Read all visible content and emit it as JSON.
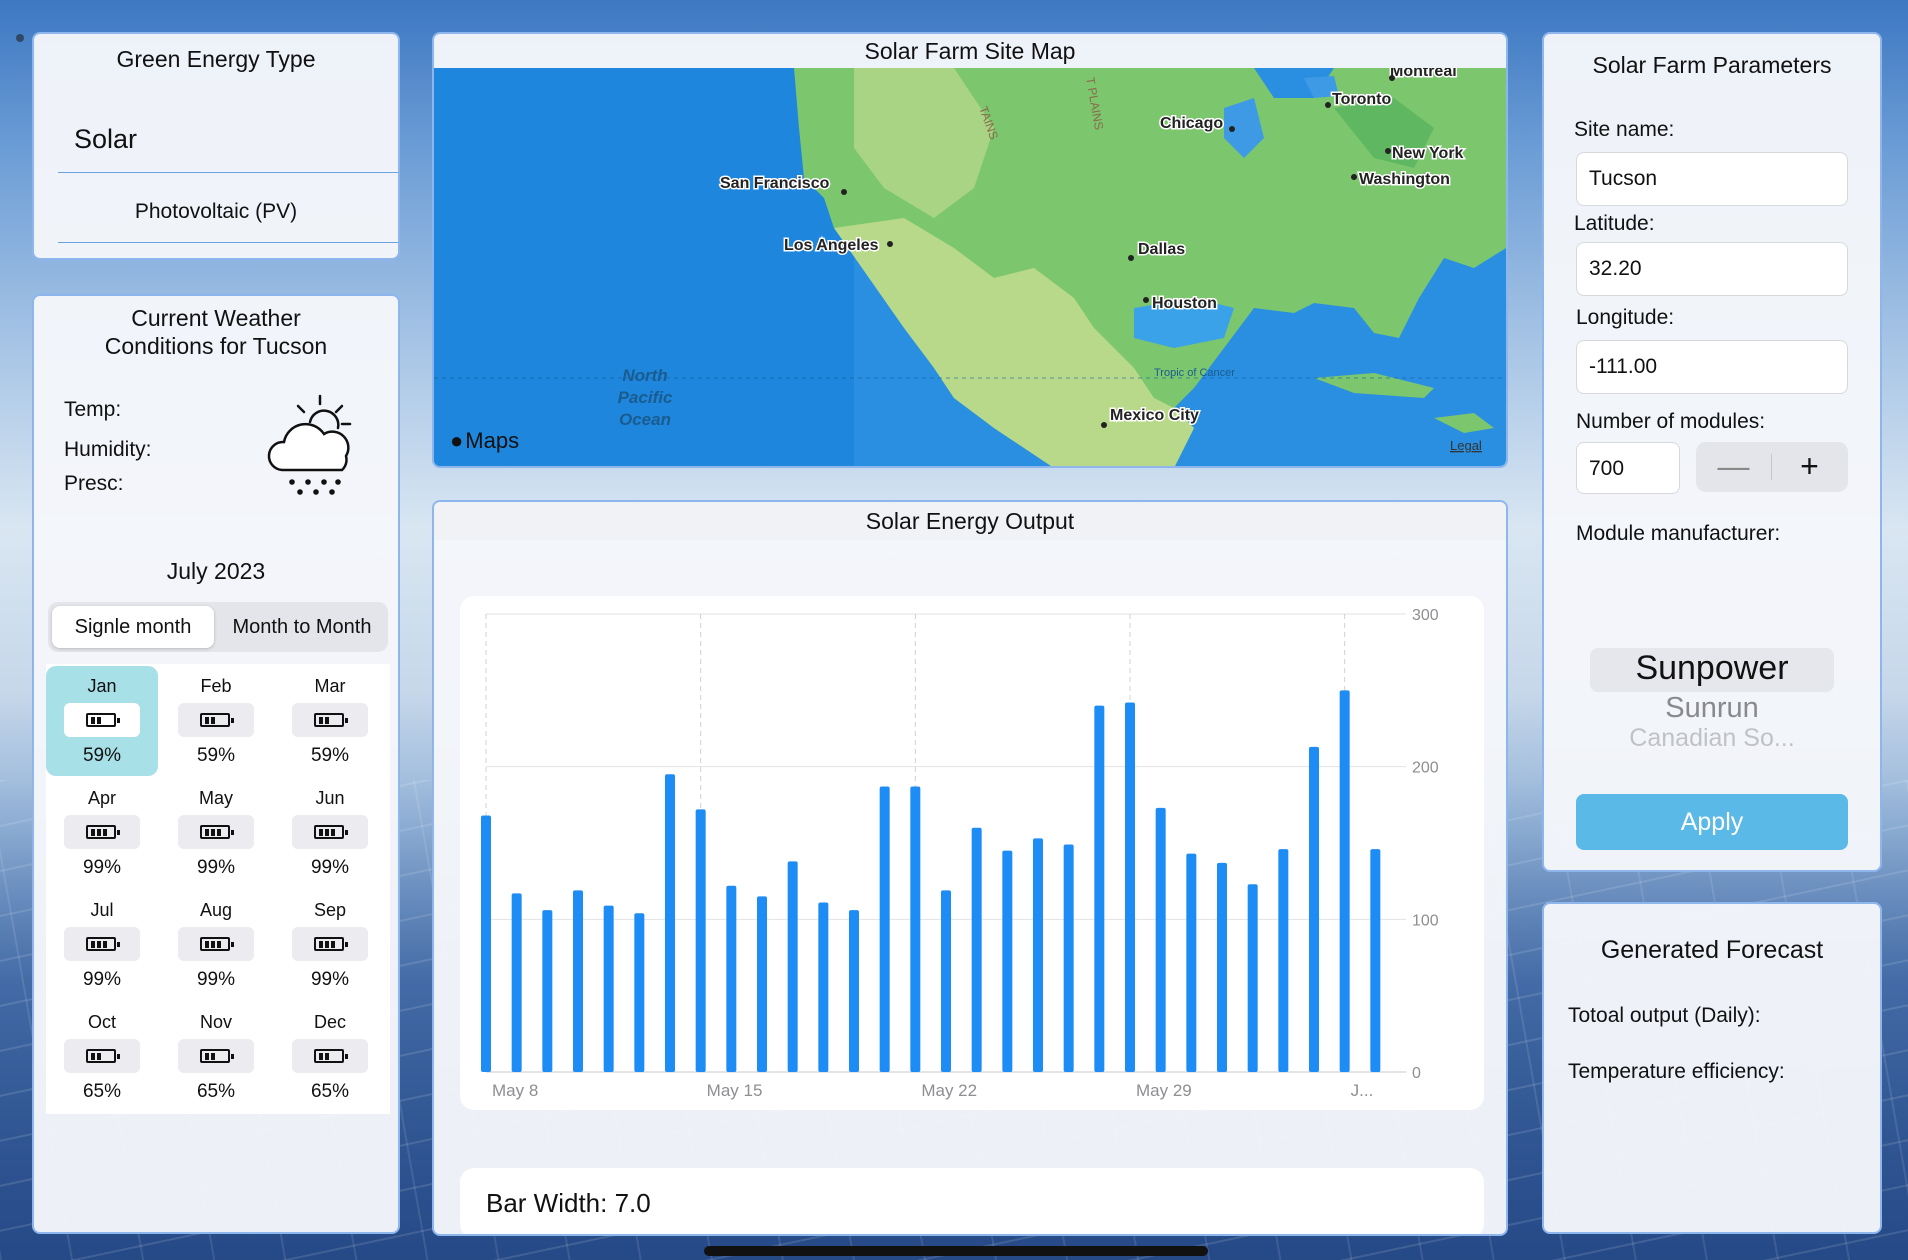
{
  "energy": {
    "title": "Green Energy Type",
    "selected": "Solar",
    "subtype": "Photovoltaic (PV)"
  },
  "weather": {
    "title": "Current Weather Conditions for Tucson",
    "labels": [
      "Temp:",
      "Humidity:",
      "Presc:"
    ],
    "icon": "cloud-sun-snow-icon",
    "month": "July 2023",
    "segments": [
      "Signle month",
      "Month to Month"
    ],
    "selected_segment": 0,
    "months": [
      {
        "name": "Jan",
        "pct": "59%",
        "selected": true
      },
      {
        "name": "Feb",
        "pct": "59%"
      },
      {
        "name": "Mar",
        "pct": "59%"
      },
      {
        "name": "Apr",
        "pct": "99%"
      },
      {
        "name": "May",
        "pct": "99%"
      },
      {
        "name": "Jun",
        "pct": "99%"
      },
      {
        "name": "Jul",
        "pct": "99%"
      },
      {
        "name": "Aug",
        "pct": "99%"
      },
      {
        "name": "Sep",
        "pct": "99%"
      },
      {
        "name": "Oct",
        "pct": "65%"
      },
      {
        "name": "Nov",
        "pct": "65%"
      },
      {
        "name": "Dec",
        "pct": "65%"
      }
    ]
  },
  "map": {
    "title": "Solar Farm Site Map",
    "attribution": "Maps",
    "legal": "Legal",
    "cities": [
      "Montreal",
      "Toronto",
      "Chicago",
      "New York",
      "Washington",
      "San Francisco",
      "Los Angeles",
      "Dallas",
      "Houston",
      "Mexico City"
    ],
    "ocean_label": [
      "North",
      "Pacific",
      "Ocean"
    ],
    "tropic_label": "Tropic of Cancer",
    "region_labels": [
      "TAINS",
      "T PLAINS"
    ]
  },
  "chart_title": "Solar Energy Output",
  "chart_data": {
    "type": "bar",
    "x": [
      "May 8",
      "May 9",
      "May 10",
      "May 11",
      "May 12",
      "May 13",
      "May 14",
      "May 15",
      "May 16",
      "May 17",
      "May 18",
      "May 19",
      "May 20",
      "May 21",
      "May 22",
      "May 23",
      "May 24",
      "May 25",
      "May 26",
      "May 27",
      "May 28",
      "May 29",
      "May 30",
      "May 31",
      "Jun 1",
      "Jun 2",
      "Jun 3",
      "Jun 4",
      "Jun 5",
      "Jun 6"
    ],
    "values": [
      168,
      117,
      106,
      119,
      109,
      104,
      195,
      172,
      122,
      115,
      138,
      111,
      106,
      187,
      187,
      119,
      160,
      145,
      153,
      149,
      240,
      242,
      173,
      143,
      137,
      123,
      146,
      213,
      250,
      146
    ],
    "x_tick_labels": [
      "May 8",
      "May 15",
      "May 22",
      "May 29",
      "J..."
    ],
    "y_ticks": [
      0,
      100,
      200,
      300
    ],
    "ylim": [
      0,
      300
    ],
    "grid": true,
    "y_axis_side": "right",
    "bar_color": "#1e8cf5"
  },
  "bar_width_label": "Bar Width: 7.0",
  "params": {
    "title": "Solar Farm Parameters",
    "site_label": "Site name:",
    "site_value": "Tucson",
    "lat_label": "Latitude:",
    "lat_value": "32.20",
    "lon_label": "Longitude:",
    "lon_value": "-111.00",
    "modules_label": "Number of modules:",
    "modules_value": "700",
    "stepper_minus": "—",
    "stepper_plus": "+",
    "manufacturer_label": "Module manufacturer:",
    "manufacturers": [
      "Sunpower",
      "Sunrun",
      "Canadian So..."
    ],
    "apply": "Apply"
  },
  "forecast": {
    "title": "Generated Forecast",
    "total_label": "Totoal output (Daily):",
    "temp_label": "Temperature efficiency:"
  }
}
